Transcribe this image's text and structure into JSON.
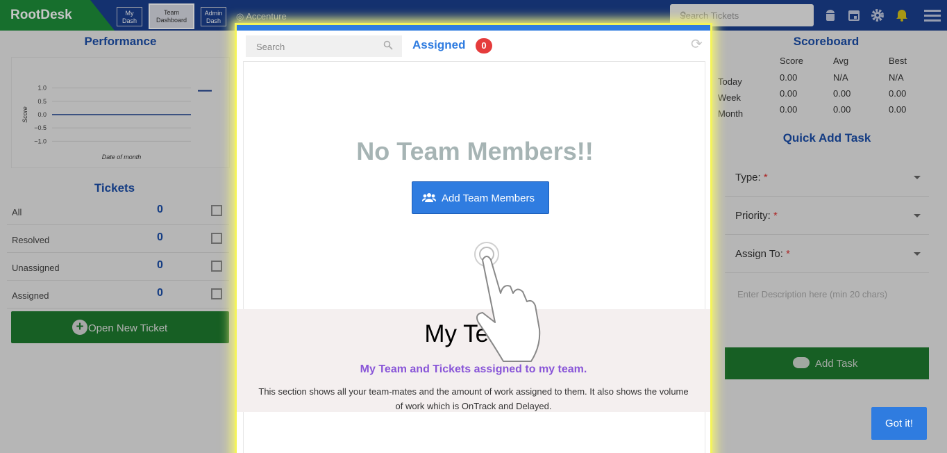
{
  "app": {
    "brand": "RootDesk",
    "nav": [
      {
        "line1": "My",
        "line2": "Dash"
      },
      {
        "line1": "Team",
        "line2": "Dashboard"
      },
      {
        "line1": "Admin",
        "line2": "Dash"
      }
    ],
    "organization": "Accenture",
    "search_placeholder": "Search Tickets",
    "icons": [
      "android-icon",
      "calendar-icon",
      "gear-icon",
      "bell-icon",
      "menu-icon"
    ],
    "colors": {
      "topbar": "#1a3f8f",
      "brand": "#1e8f3a",
      "accent": "#2f7ce0",
      "badge": "#e53b3b",
      "subtitle": "#8956d8"
    }
  },
  "performance": {
    "title": "Performance",
    "chart_data": {
      "type": "line",
      "xlabel": "Date of month",
      "ylabel": "Score",
      "y_ticks": [
        "1.0",
        "0.5",
        "0.0",
        "−0.5",
        "−1.0"
      ],
      "ylim": [
        -1.2,
        1.2
      ],
      "series": [
        {
          "values": [
            0,
            0
          ]
        }
      ],
      "grid": true
    }
  },
  "tickets": {
    "title": "Tickets",
    "rows": [
      {
        "label": "All",
        "count": "0"
      },
      {
        "label": "Resolved",
        "count": "0"
      },
      {
        "label": "Unassigned",
        "count": "0"
      },
      {
        "label": "Assigned",
        "count": "0"
      }
    ],
    "open_new_ticket": "Open New Ticket"
  },
  "scoreboard": {
    "title": "Scoreboard",
    "columns": [
      "Score",
      "Avg",
      "Best"
    ],
    "rows": [
      {
        "label": "Today",
        "values": [
          "0.00",
          "N/A",
          "N/A"
        ]
      },
      {
        "label": "Week",
        "values": [
          "0.00",
          "0.00",
          "0.00"
        ]
      },
      {
        "label": "Month",
        "values": [
          "0.00",
          "0.00",
          "0.00"
        ]
      }
    ]
  },
  "quick_add": {
    "title": "Quick Add Task",
    "fields": [
      "Type:",
      "Priority:",
      "Assign To:"
    ],
    "required_mark": "*",
    "description_placeholder": "Enter Description here (min 20 chars)",
    "add_task": "Add Task"
  },
  "tour": {
    "search_placeholder": "Search",
    "tab_label": "Assigned",
    "tab_count": "0",
    "empty_title": "No Team Members!!",
    "add_button": "Add Team Members",
    "heading": "My Team",
    "subtitle": "My Team and Tickets assigned to my team.",
    "description": "This section shows all your team-mates and the amount of work assigned to them. It also shows the volume of work which is OnTrack and Delayed.",
    "got_it": "Got it!"
  }
}
